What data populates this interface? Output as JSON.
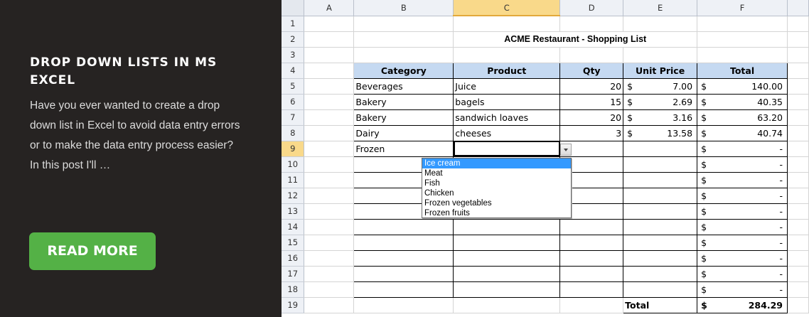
{
  "card": {
    "title": "DROP DOWN LISTS IN MS EXCEL",
    "excerpt": "Have you ever wanted to create a drop down list in Excel to avoid data entry errors or to make the data entry process easier? In this post I'll …",
    "button_label": "READ MORE",
    "accent": "#54b146"
  },
  "sheet": {
    "columns": [
      "A",
      "B",
      "C",
      "D",
      "E",
      "F"
    ],
    "selected_column": "C",
    "rows": [
      "1",
      "2",
      "3",
      "4",
      "5",
      "6",
      "7",
      "8",
      "9",
      "10",
      "11",
      "12",
      "13",
      "14",
      "15",
      "16",
      "17",
      "18",
      "19"
    ],
    "selected_row": "9",
    "title": "ACME Restaurant - Shopping List",
    "headers": [
      "Category",
      "Product",
      "Qty",
      "Unit Price",
      "Total"
    ],
    "currency": "$",
    "items": [
      {
        "category": "Beverages",
        "product": "Juice",
        "qty": "20",
        "price": "7.00",
        "total": "140.00"
      },
      {
        "category": "Bakery",
        "product": " bagels",
        "qty": "15",
        "price": "2.69",
        "total": "40.35"
      },
      {
        "category": "Bakery",
        "product": "sandwich loaves",
        "qty": "20",
        "price": "3.16",
        "total": "63.20"
      },
      {
        "category": "Dairy",
        "product": "cheeses",
        "qty": "3",
        "price": "13.58",
        "total": "40.74"
      },
      {
        "category": "Frozen",
        "product": "",
        "qty": "",
        "price": "",
        "total": "-"
      }
    ],
    "empty_total": "-",
    "footer_label": "Total",
    "grand_total": "284.29",
    "dropdown": {
      "options": [
        "Ice cream",
        "Meat",
        "Fish",
        "Chicken",
        "Frozen vegetables",
        "Frozen fruits"
      ],
      "highlighted": "Ice cream"
    }
  }
}
